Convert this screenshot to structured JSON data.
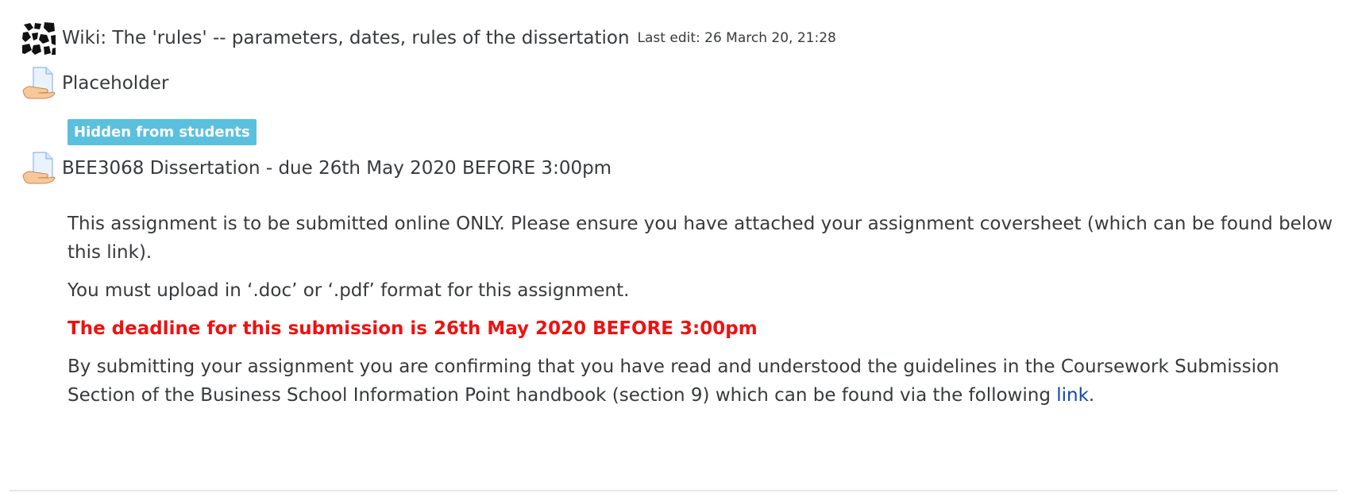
{
  "activities": {
    "wiki": {
      "icon": "wiki-icon",
      "title": "Wiki: The 'rules' -- parameters, dates, rules of the dissertation",
      "last_edit": "Last edit: 26 March 20, 21:28"
    },
    "placeholder": {
      "icon": "assignment-icon",
      "title": "Placeholder",
      "badge": "Hidden from students"
    },
    "dissertation": {
      "icon": "assignment-icon",
      "title": "BEE3068 Dissertation - due 26th May 2020 BEFORE 3:00pm",
      "description": {
        "p1": "This assignment is to be submitted online ONLY. Please ensure you have attached your assignment coversheet (which can be found below this link).",
        "p2": "You must upload in ‘.doc’ or ‘.pdf’ format for this assignment.",
        "deadline": "The deadline for this submission is 26th May 2020 BEFORE 3:00pm",
        "p4_text": "By submitting your assignment you are confirming that you have read and understood the guidelines in the Coursework Submission Section of the Business School Information Point handbook (section 9) which can be found via the following ",
        "p4_link": "link",
        "p4_end": "."
      }
    }
  },
  "colors": {
    "badge_bg": "#5bc0de",
    "deadline_text": "#ee1111",
    "link": "#0f47ad"
  }
}
